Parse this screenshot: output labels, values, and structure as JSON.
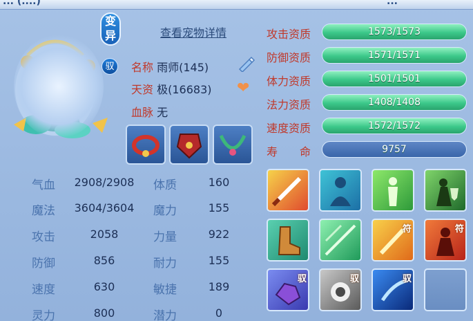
{
  "top_left_title": "... (....)",
  "top_right_title": "...",
  "badge": "变\n异",
  "badge_top": "变",
  "badge_bottom": "异",
  "yu_symbol": "驭",
  "view_details": "查看宠物详情",
  "info": {
    "name_label": "名称",
    "name_value": "雨师(145)",
    "aptitude_label": "天资",
    "aptitude_value": "极(16683)",
    "blood_label": "血脉",
    "blood_value": "无"
  },
  "attrs_left": [
    {
      "label": "气血",
      "value": "2908/2908"
    },
    {
      "label": "魔法",
      "value": "3604/3604"
    },
    {
      "label": "攻击",
      "value": "2058"
    },
    {
      "label": "防御",
      "value": "856"
    },
    {
      "label": "速度",
      "value": "630"
    },
    {
      "label": "灵力",
      "value": "800"
    }
  ],
  "attrs_right": [
    {
      "label": "体质",
      "value": "160"
    },
    {
      "label": "魔力",
      "value": "155"
    },
    {
      "label": "力量",
      "value": "922"
    },
    {
      "label": "耐力",
      "value": "155"
    },
    {
      "label": "敏捷",
      "value": "189"
    },
    {
      "label": "潜力",
      "value": "0"
    }
  ],
  "qualities": [
    {
      "label": "攻击资质",
      "value": "1573/1573",
      "fill": 1.0
    },
    {
      "label": "防御资质",
      "value": "1571/1571",
      "fill": 1.0
    },
    {
      "label": "体力资质",
      "value": "1501/1501",
      "fill": 1.0
    },
    {
      "label": "法力资质",
      "value": "1408/1408",
      "fill": 1.0
    },
    {
      "label": "速度资质",
      "value": "1572/1572",
      "fill": 1.0
    }
  ],
  "life": {
    "label": "寿　　命",
    "value": "9757"
  },
  "skill_tags": {
    "fu": "符",
    "yu": "驭"
  },
  "colors": {
    "accent_red": "#c0392b",
    "bar_green": "#3cc88a",
    "panel_blue": "#93b2dc"
  }
}
